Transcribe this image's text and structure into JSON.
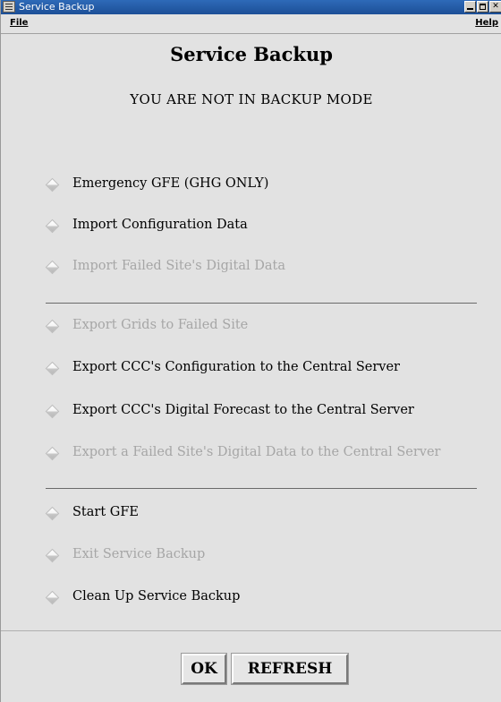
{
  "window": {
    "title": "Service Backup"
  },
  "menubar": {
    "file": "File",
    "help": "Help"
  },
  "heading": "Service Backup",
  "status": "YOU ARE NOT IN BACKUP MODE",
  "options": [
    {
      "label": "Emergency GFE (GHG ONLY)",
      "enabled": true
    },
    {
      "label": "Import Configuration Data",
      "enabled": true
    },
    {
      "label": "Import Failed Site's Digital Data",
      "enabled": false
    },
    {
      "label": "Export Grids to Failed Site",
      "enabled": false
    },
    {
      "label": "Export CCC's Configuration to the Central Server",
      "enabled": true
    },
    {
      "label": "Export CCC's Digital Forecast to the Central Server",
      "enabled": true
    },
    {
      "label": "Export a Failed Site's Digital Data to the Central Server",
      "enabled": false
    },
    {
      "label": "Start GFE",
      "enabled": true
    },
    {
      "label": "Exit Service Backup",
      "enabled": false
    },
    {
      "label": "Clean Up Service Backup",
      "enabled": true
    }
  ],
  "buttons": {
    "ok": "OK",
    "refresh": "REFRESH"
  },
  "colors": {
    "titlebar": "#1c4f97",
    "background": "#e2e2e2",
    "disabled_text": "#a6a6a6"
  },
  "icons": {
    "option_marker": "diamond-radio-icon"
  }
}
